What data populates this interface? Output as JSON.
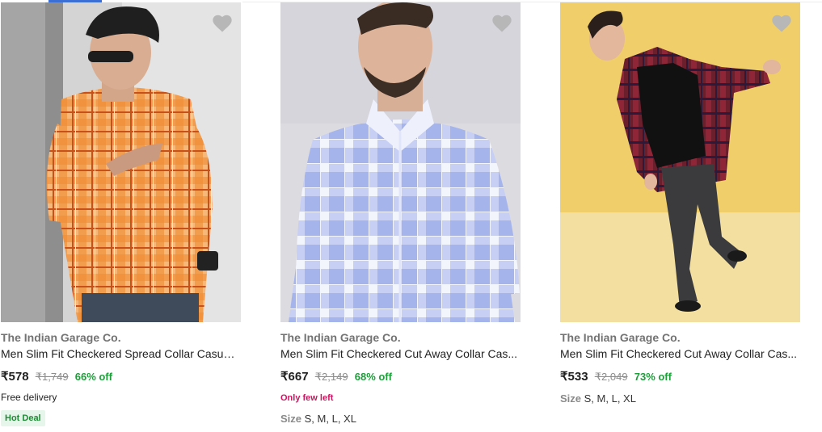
{
  "products": [
    {
      "brand": "The Indian Garage Co.",
      "title": "Men Slim Fit Checkered Spread Collar Casual...",
      "price": "₹578",
      "mrp": "₹1,749",
      "discount": "66% off",
      "delivery": "Free delivery",
      "badge": "Hot Deal",
      "image_subject": "man in orange checkered shirt",
      "wishlist_icon": "heart-icon"
    },
    {
      "brand": "The Indian Garage Co.",
      "title": "Men Slim Fit Checkered Cut Away Collar Cas...",
      "price": "₹667",
      "mrp": "₹2,149",
      "discount": "68% off",
      "stock": "Only few left",
      "size_label": "Size",
      "sizes": "S, M, L, XL",
      "image_subject": "man in blue and white checkered shirt",
      "wishlist_icon": "heart-icon"
    },
    {
      "brand": "The Indian Garage Co.",
      "title": "Men Slim Fit Checkered Cut Away Collar Cas...",
      "price": "₹533",
      "mrp": "₹2,049",
      "discount": "73% off",
      "size_label": "Size",
      "sizes": "S, M, L, XL",
      "image_subject": "man in maroon checkered shirt on yellow background",
      "wishlist_icon": "heart-icon"
    }
  ],
  "colors": {
    "discount": "#1f9d3b",
    "stock_warning": "#d0135f",
    "badge_bg": "#e6f6ea",
    "accent": "#3b6fd6"
  }
}
